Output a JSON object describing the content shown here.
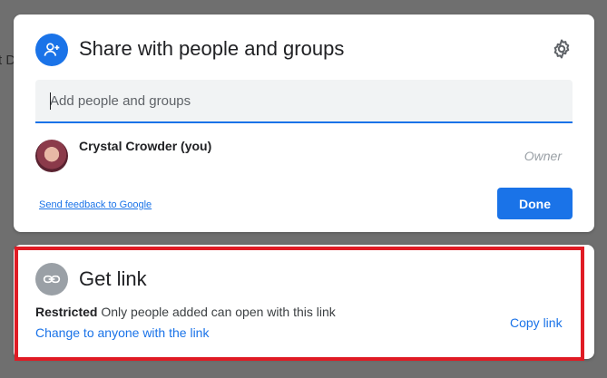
{
  "background": {
    "partial_text": "t D"
  },
  "share_dialog": {
    "title": "Share with people and groups",
    "add_icon": "person-add-icon",
    "settings_icon": "gear-icon",
    "input": {
      "placeholder": "Add people and groups",
      "value": ""
    },
    "people": [
      {
        "name": "Crystal Crowder (you)",
        "role": "Owner"
      }
    ],
    "feedback_link": "Send feedback to Google",
    "done_label": "Done",
    "accent_color": "#1a73e8"
  },
  "link_section": {
    "title": "Get link",
    "icon": "link-icon",
    "access_level": "Restricted",
    "access_description": "Only people added can open with this link",
    "change_link": "Change to anyone with the link",
    "copy_link": "Copy link",
    "highlight_color": "#e01b24"
  }
}
